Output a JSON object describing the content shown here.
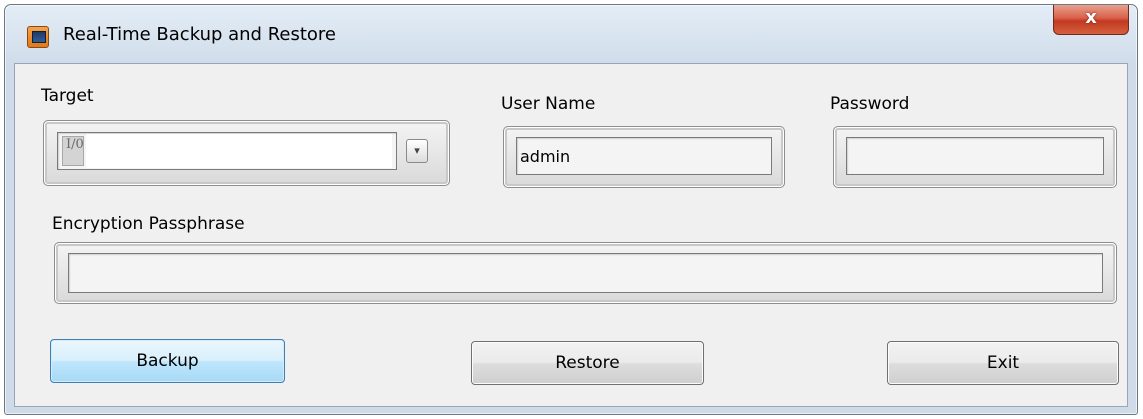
{
  "window": {
    "title": "Real-Time Backup and Restore",
    "close_label": "x"
  },
  "target": {
    "label": "Target",
    "io_tag": "I/0",
    "value": "",
    "dropdown_icon": "chevron-down-icon"
  },
  "user_name": {
    "label": "User Name",
    "value": "admin"
  },
  "password": {
    "label": "Password",
    "value": ""
  },
  "encryption": {
    "label": "Encryption Passphrase",
    "value": ""
  },
  "buttons": {
    "backup": "Backup",
    "restore": "Restore",
    "exit": "Exit"
  },
  "colors": {
    "close_button": "#c2391f",
    "focused_button": "#3c7fb1",
    "client_bg": "#f0f0f0"
  }
}
